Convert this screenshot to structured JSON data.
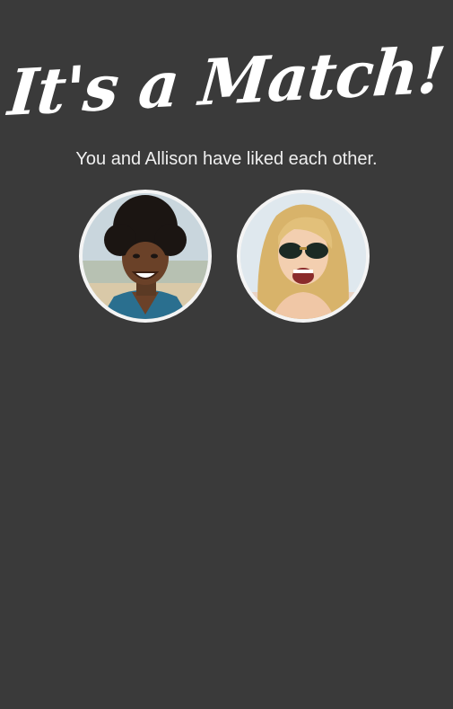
{
  "match_screen": {
    "title": "It's a Match!",
    "subtitle": "You and Allison have liked each other."
  },
  "avatars": [
    {
      "id": "self",
      "icon": "user-photo"
    },
    {
      "id": "allison",
      "icon": "match-photo"
    }
  ],
  "colors": {
    "background": "#3a3a3a",
    "text": "#ffffff",
    "avatar_border": "#f4f4f4"
  }
}
